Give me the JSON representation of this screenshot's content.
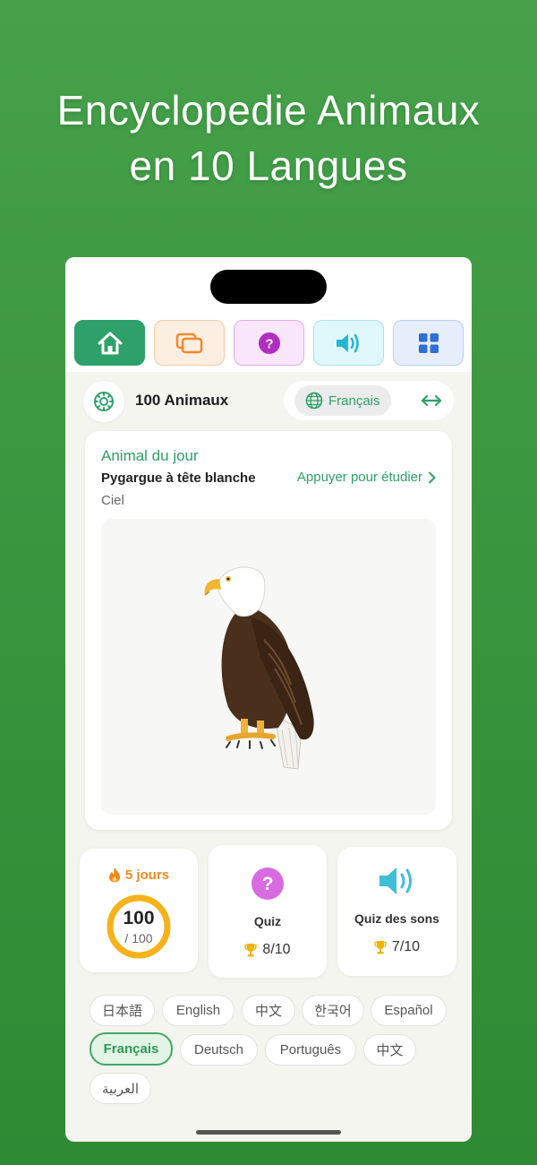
{
  "headline": {
    "line1": "Encyclopedie Animaux",
    "line2": "en 10 Langues"
  },
  "colors": {
    "background": "#3f9a44",
    "accent": "#2ea06a",
    "streak": "#f08a1e",
    "quiz": "#d96be0",
    "sound": "#3fbfd6",
    "grid": "#2f6fd6"
  },
  "tabs": [
    {
      "icon": "home-icon"
    },
    {
      "icon": "cards-icon"
    },
    {
      "icon": "question-icon"
    },
    {
      "icon": "speaker-icon"
    },
    {
      "icon": "grid-icon"
    }
  ],
  "toolbar": {
    "title": "100 Animaux",
    "language": "Français"
  },
  "animal_of_day": {
    "title": "Animal du jour",
    "name": "Pygargue à tête blanche",
    "study_link": "Appuyer pour étudier",
    "habitat": "Ciel",
    "image": "bald-eagle"
  },
  "stats": {
    "streak": {
      "label": "5 jours",
      "learned": "100",
      "total": "/ 100",
      "progress": 1.0
    },
    "quiz": {
      "label": "Quiz",
      "score": "8/10"
    },
    "sound_quiz": {
      "label": "Quiz des sons",
      "score": "7/10"
    }
  },
  "languages": [
    {
      "label": "日本語",
      "active": false
    },
    {
      "label": "English",
      "active": false
    },
    {
      "label": "中文",
      "active": false
    },
    {
      "label": "한국어",
      "active": false
    },
    {
      "label": "Español",
      "active": false
    },
    {
      "label": "Français",
      "active": true
    },
    {
      "label": "Deutsch",
      "active": false
    },
    {
      "label": "Português",
      "active": false
    },
    {
      "label": "中文",
      "active": false
    },
    {
      "label": "العربية",
      "active": false
    }
  ]
}
